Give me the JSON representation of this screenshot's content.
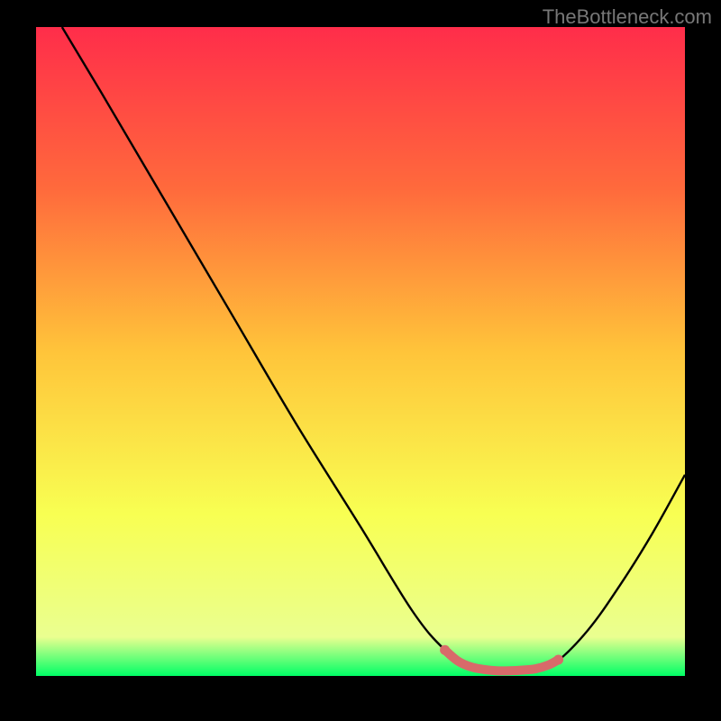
{
  "watermark": "TheBottleneck.com",
  "chart_data": {
    "type": "line",
    "title": "",
    "xlabel": "",
    "ylabel": "",
    "xlim": [
      0,
      100
    ],
    "ylim": [
      0,
      100
    ],
    "gradient_stops": [
      {
        "offset": 0,
        "color": "#ff2d4a"
      },
      {
        "offset": 25,
        "color": "#ff6a3c"
      },
      {
        "offset": 50,
        "color": "#ffc43a"
      },
      {
        "offset": 75,
        "color": "#f8ff52"
      },
      {
        "offset": 94,
        "color": "#eaff90"
      },
      {
        "offset": 100,
        "color": "#00ff66"
      }
    ],
    "curve": [
      {
        "x": 4,
        "y": 100
      },
      {
        "x": 10,
        "y": 90
      },
      {
        "x": 20,
        "y": 73
      },
      {
        "x": 30,
        "y": 56
      },
      {
        "x": 40,
        "y": 39
      },
      {
        "x": 50,
        "y": 23
      },
      {
        "x": 58,
        "y": 10
      },
      {
        "x": 63,
        "y": 4
      },
      {
        "x": 67,
        "y": 1.2
      },
      {
        "x": 72,
        "y": 0.8
      },
      {
        "x": 77,
        "y": 1.0
      },
      {
        "x": 80,
        "y": 2
      },
      {
        "x": 85,
        "y": 7
      },
      {
        "x": 90,
        "y": 14
      },
      {
        "x": 95,
        "y": 22
      },
      {
        "x": 100,
        "y": 31
      }
    ],
    "highlight_segment": [
      {
        "x": 63,
        "y": 4
      },
      {
        "x": 65,
        "y": 2.3
      },
      {
        "x": 67,
        "y": 1.4
      },
      {
        "x": 69,
        "y": 1.0
      },
      {
        "x": 71,
        "y": 0.8
      },
      {
        "x": 73,
        "y": 0.8
      },
      {
        "x": 75,
        "y": 0.9
      },
      {
        "x": 77,
        "y": 1.1
      },
      {
        "x": 79,
        "y": 1.7
      },
      {
        "x": 80.5,
        "y": 2.5
      }
    ],
    "highlight_color": "#d86a6a"
  }
}
